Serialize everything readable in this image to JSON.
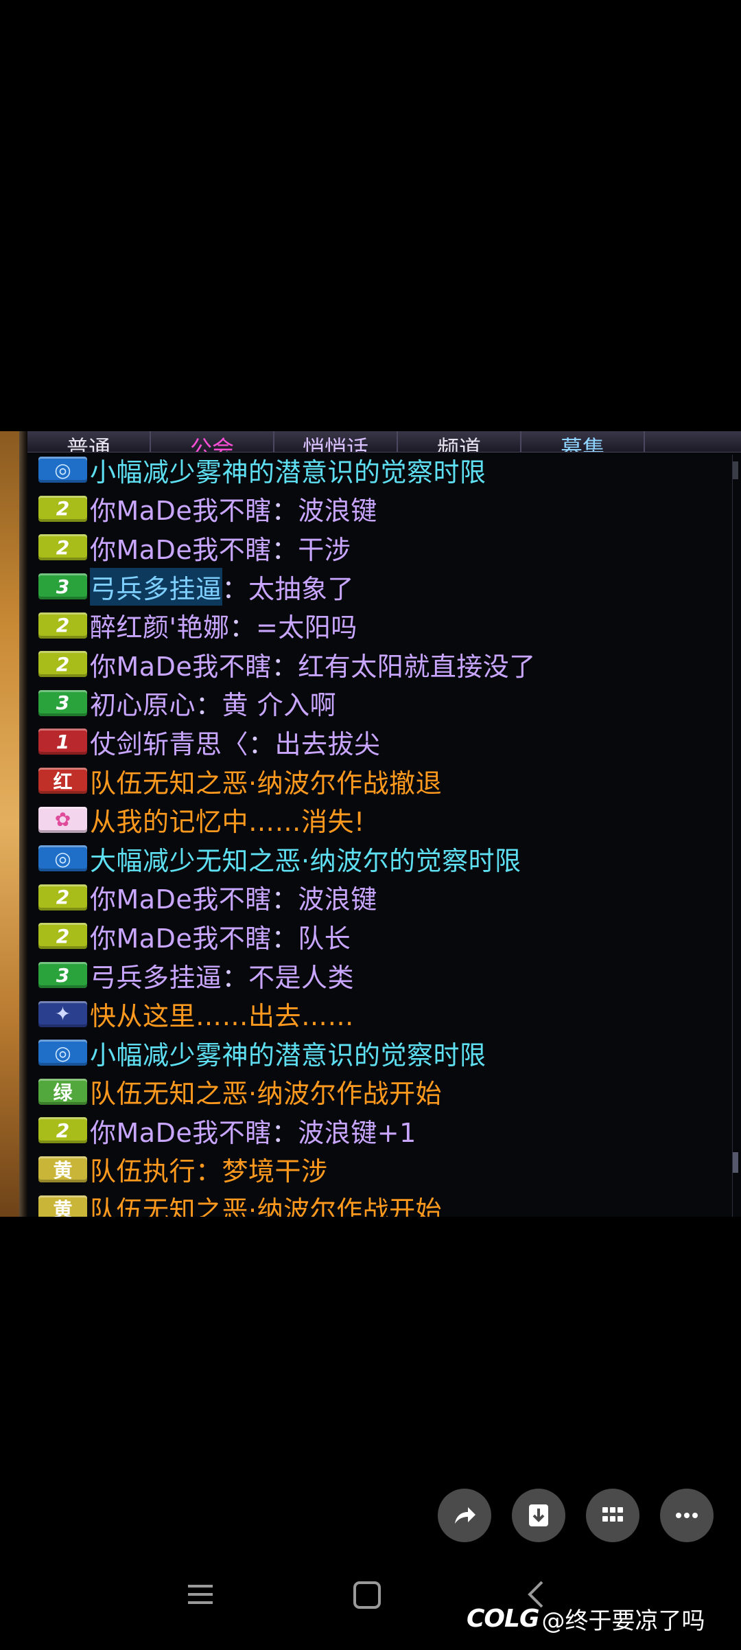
{
  "tabs": [
    {
      "label": "普通",
      "color": "#e8e4f0"
    },
    {
      "label": "公会",
      "color": "#ff4fd8"
    },
    {
      "label": "悄悄话",
      "color": "#d9c2ff"
    },
    {
      "label": "频道",
      "color": "#e8e4f0"
    },
    {
      "label": "募集",
      "color": "#8fd3ff"
    }
  ],
  "messages": [
    {
      "badge": "◎",
      "badge_type": "sys",
      "sender": "",
      "sep": "",
      "text": "小幅减少雾神的潜意识的觉察时限",
      "color": "cyan"
    },
    {
      "badge": "2",
      "badge_type": "lv2",
      "sender": "你MaDe我不瞎",
      "sep": "：",
      "text": "波浪键",
      "color": "purple"
    },
    {
      "badge": "2",
      "badge_type": "lv2",
      "sender": "你MaDe我不瞎",
      "sep": "：",
      "text": "干涉",
      "color": "purple"
    },
    {
      "badge": "3",
      "badge_type": "lv3",
      "sender": "弓兵多挂逼",
      "sep": "：",
      "text": "太抽象了",
      "color": "purple",
      "highlight": true
    },
    {
      "badge": "2",
      "badge_type": "lv2",
      "sender": "醉红颜'艳娜",
      "sep": "：",
      "text": "=太阳吗",
      "color": "purple"
    },
    {
      "badge": "2",
      "badge_type": "lv2",
      "sender": "你MaDe我不瞎",
      "sep": "：",
      "text": "红有太阳就直接没了",
      "color": "purple"
    },
    {
      "badge": "3",
      "badge_type": "lv3",
      "sender": "初心原心",
      "sep": "：",
      "text": "黄 介入啊",
      "color": "purple"
    },
    {
      "badge": "1",
      "badge_type": "lv1",
      "sender": "仗剑斩青思〈",
      "sep": "：",
      "text": "出去拔尖",
      "color": "purple"
    },
    {
      "badge": "红",
      "badge_type": "red",
      "sender": "",
      "sep": "",
      "text": "队伍无知之恶·纳波尔作战撤退",
      "color": "orange"
    },
    {
      "badge": "✿",
      "badge_type": "pink",
      "sender": "",
      "sep": "",
      "text": "从我的记忆中……消失!",
      "color": "orange"
    },
    {
      "badge": "◎",
      "badge_type": "sys",
      "sender": "",
      "sep": "",
      "text": "大幅减少无知之恶·纳波尔的觉察时限",
      "color": "cyan"
    },
    {
      "badge": "2",
      "badge_type": "lv2",
      "sender": "你MaDe我不瞎",
      "sep": "：",
      "text": "波浪键",
      "color": "purple"
    },
    {
      "badge": "2",
      "badge_type": "lv2",
      "sender": "你MaDe我不瞎",
      "sep": "：",
      "text": "队长",
      "color": "purple"
    },
    {
      "badge": "3",
      "badge_type": "lv3",
      "sender": "弓兵多挂逼",
      "sep": "：",
      "text": "不是人类",
      "color": "purple"
    },
    {
      "badge": "✦",
      "badge_type": "star",
      "sender": "",
      "sep": "",
      "text": "快从这里……出去……",
      "color": "orange"
    },
    {
      "badge": "◎",
      "badge_type": "sys",
      "sender": "",
      "sep": "",
      "text": "小幅减少雾神的潜意识的觉察时限",
      "color": "cyan"
    },
    {
      "badge": "绿",
      "badge_type": "green",
      "sender": "",
      "sep": "",
      "text": "队伍无知之恶·纳波尔作战开始",
      "color": "orange"
    },
    {
      "badge": "2",
      "badge_type": "lv2",
      "sender": "你MaDe我不瞎",
      "sep": "：",
      "text": "波浪键+1",
      "color": "purple"
    },
    {
      "badge": "黄",
      "badge_type": "yellow",
      "sender": "",
      "sep": "",
      "text": "队伍执行：梦境干涉",
      "color": "orange"
    },
    {
      "badge": "黄",
      "badge_type": "yellow",
      "sender": "",
      "sep": "",
      "text": "队伍无知之恶·纳波尔作战开始",
      "color": "orange"
    }
  ],
  "actions": [
    {
      "name": "share-button",
      "icon": "share-icon"
    },
    {
      "name": "download-button",
      "icon": "download-icon"
    },
    {
      "name": "grid-button",
      "icon": "grid-icon"
    },
    {
      "name": "more-button",
      "icon": "more-icon"
    }
  ],
  "watermark": {
    "logo": "COLG",
    "text": "@终于要凉了吗"
  },
  "nav": [
    "menu-icon",
    "home-icon",
    "back-icon"
  ]
}
